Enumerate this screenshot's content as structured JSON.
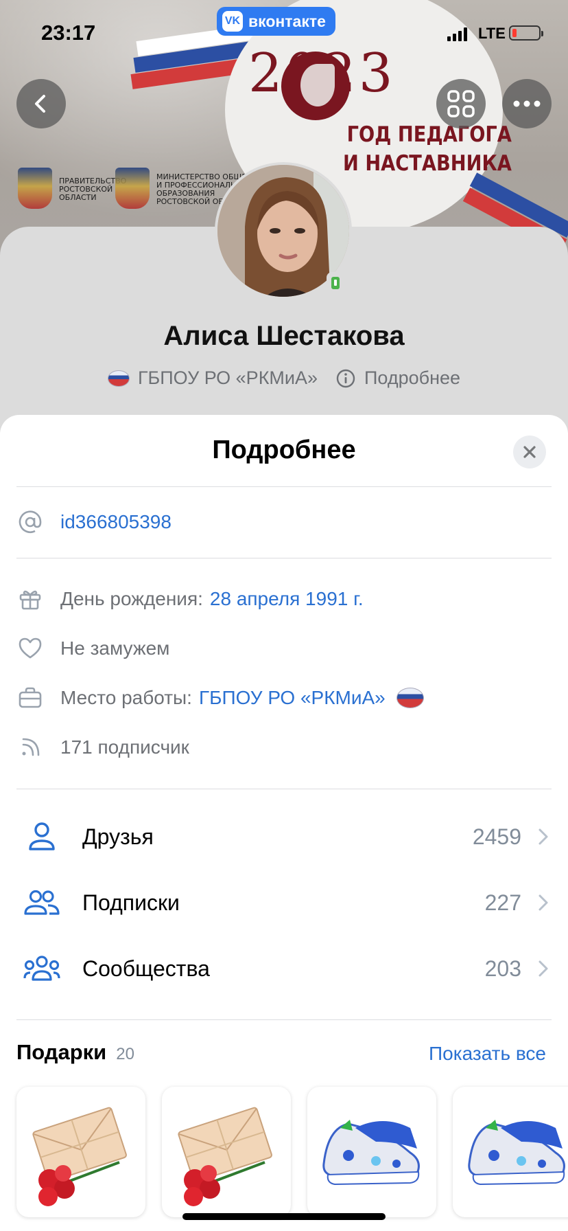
{
  "status": {
    "time": "23:17",
    "network": "LTE",
    "app_pill": "вконтакте",
    "vk_letters": "VK"
  },
  "cover": {
    "year": "2023",
    "headline_line1": "ГОД ПЕДАГОГА",
    "headline_line2": "И НАСТАВНИКА",
    "org1": "ПРАВИТЕЛЬСТВО\nРОСТОВСКОЙ\nОБЛАСТИ",
    "org2": "МИНИСТЕРСТВО ОБЩЕГО\nИ ПРОФЕССИОНАЛЬНОГО\nОБРАЗОВАНИЯ\nРОСТОВСКОЙ ОБЛАСТИ"
  },
  "profile": {
    "name": "Алиса Шестакова",
    "workplace": "ГБПОУ РО «РКМиА»",
    "details_link": "Подробнее"
  },
  "sheet": {
    "title": "Подробнее",
    "id": "id366805398",
    "birthday_label": "День рождения:",
    "birthday_value": "28 апреля 1991 г.",
    "relationship": "Не замужем",
    "work_label": "Место работы:",
    "work_value": "ГБПОУ РО «РКМиА»",
    "followers": "171 подписчик"
  },
  "nav": [
    {
      "label": "Друзья",
      "count": "2459"
    },
    {
      "label": "Подписки",
      "count": "227"
    },
    {
      "label": "Сообщества",
      "count": "203"
    }
  ],
  "gifts": {
    "title": "Подарки",
    "count": "20",
    "show_all": "Показать все"
  },
  "colors": {
    "accent": "#2a70d1",
    "vk_blue": "#2f7bf1",
    "online": "#4bb34b"
  }
}
